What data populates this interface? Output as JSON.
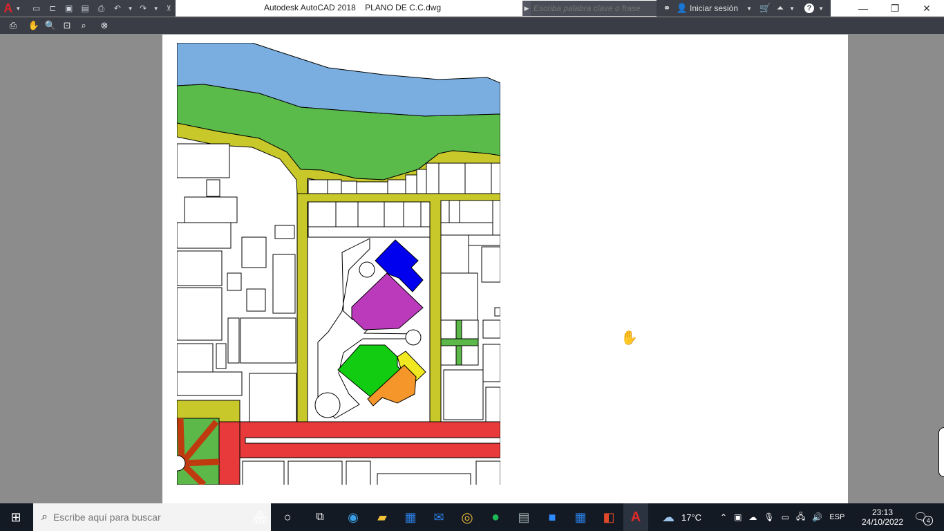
{
  "window": {
    "title": "Autodesk AutoCAD 2018    PLANO DE C.C.dwg",
    "search_placeholder": "Escriba palabra clave o frase",
    "signin": "Iniciar sesión"
  },
  "taskbar": {
    "search_placeholder": "Escribe aquí para buscar",
    "weather": "17°C",
    "language": "ESP",
    "time": "23:13",
    "date": "24/10/2022",
    "notifications": "4"
  },
  "colors": {
    "water": "#7aaee0",
    "park": "#5aba4a",
    "road": "#c8c82a",
    "avenue": "#e83a3a",
    "blue_block": "#0000ee",
    "magenta_block": "#bb3abb",
    "green_block": "#11cc11",
    "yellow_block": "#f0e820",
    "orange_block": "#f5962a",
    "plaza": "#5cb848",
    "plaza_paths": "#c03a10"
  }
}
